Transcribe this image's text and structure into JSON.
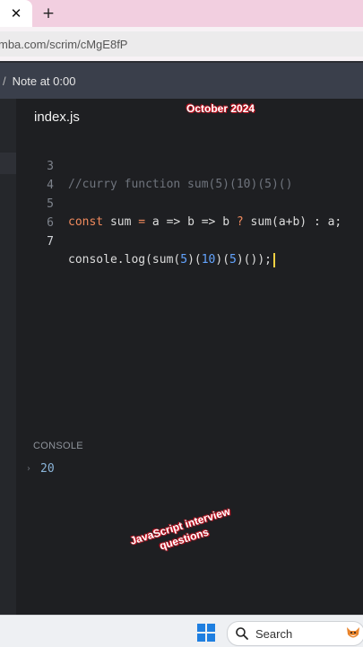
{
  "browser": {
    "close_tab_glyph": "✕",
    "new_tab_glyph": "+",
    "url": "mba.com/scrim/cMgE8fP"
  },
  "note_bar": {
    "divider": "/",
    "text": "Note at 0:00"
  },
  "editor": {
    "filename": "index.js",
    "watermark": "October 2024",
    "lines": [
      {
        "number": "3",
        "text": "//curry function sum(5)(10)(5)()"
      },
      {
        "number": "4",
        "text": ""
      },
      {
        "number": "5",
        "text": "const sum = a => b => b ? sum(a+b) : a;"
      },
      {
        "number": "6",
        "text": ""
      },
      {
        "number": "7",
        "text": "console.log(sum(5)(10)(5)());"
      }
    ],
    "line5_parts": {
      "kw": "const",
      "name": " sum ",
      "eq": "=",
      "rest1": " a => b => b ",
      "q": "?",
      "rest2": " sum(a+b) : a;"
    },
    "line7_parts": {
      "p1": "console.log(sum(",
      "n1": "5",
      "p2": ")(",
      "n2": "10",
      "p3": ")(",
      "n3": "5",
      "p4": ")());"
    }
  },
  "console": {
    "label": "CONSOLE",
    "arrow": "›",
    "output": "20"
  },
  "overlay_caption": {
    "line1": "JavaScript interview",
    "line2": "questions"
  },
  "taskbar": {
    "search_placeholder": "Search"
  },
  "colors": {
    "keyword": "#f08a5d",
    "number": "#63a4ff",
    "comment": "#6f747d",
    "tabbar": "#f2cfe0"
  }
}
